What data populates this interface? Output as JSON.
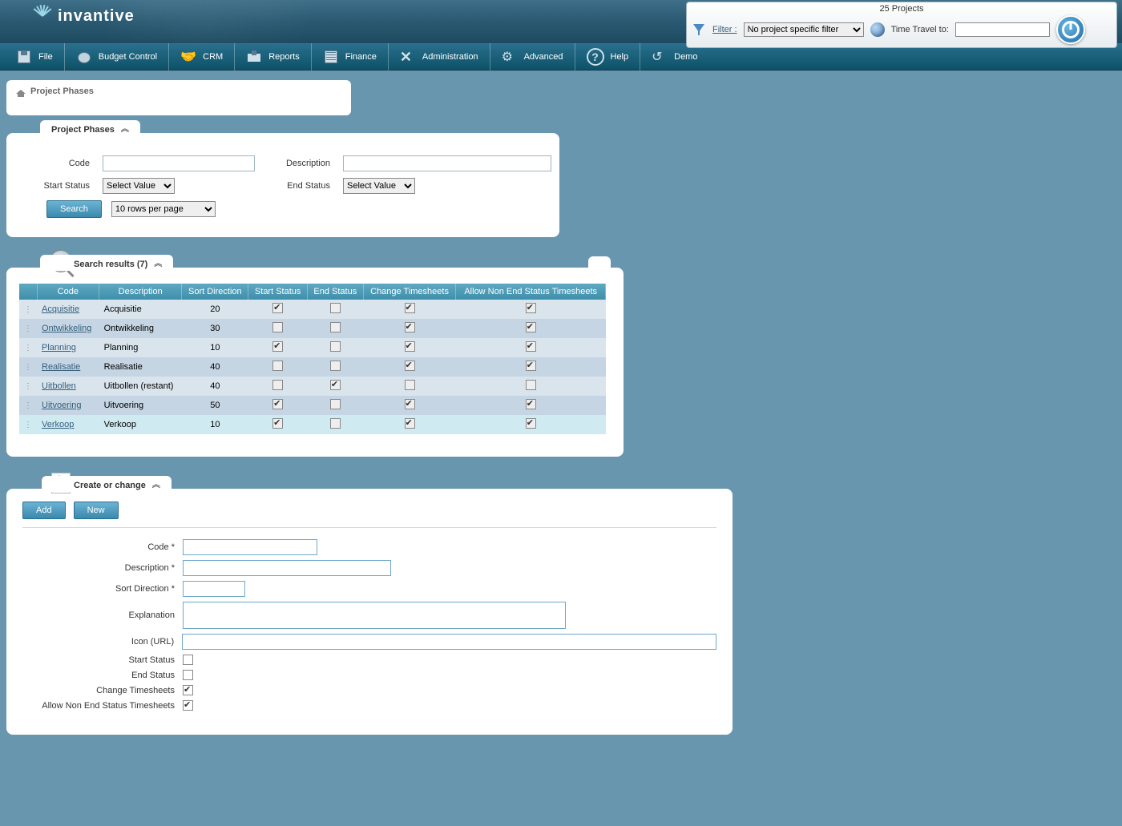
{
  "brand": "invantive",
  "topright": {
    "project_count": "25 Projects",
    "filter_label": "Filter :",
    "filter_value": "No project specific filter",
    "time_travel_label": "Time Travel to:"
  },
  "menu": {
    "file": "File",
    "budget": "Budget Control",
    "crm": "CRM",
    "reports": "Reports",
    "finance": "Finance",
    "admin": "Administration",
    "advanced": "Advanced",
    "help": "Help",
    "demo": "Demo"
  },
  "breadcrumb": "Project Phases",
  "search_panel": {
    "title": "Project Phases",
    "code_label": "Code",
    "desc_label": "Description",
    "start_label": "Start Status",
    "end_label": "End Status",
    "select_value": "Select Value",
    "rows_per_page": "10 rows per page",
    "search_btn": "Search"
  },
  "results": {
    "title": "Search results (7)",
    "headers": {
      "code": "Code",
      "desc": "Description",
      "sort": "Sort Direction",
      "start": "Start Status",
      "end": "End Status",
      "change": "Change Timesheets",
      "allow": "Allow Non End Status Timesheets"
    },
    "rows": [
      {
        "code": "Acquisitie",
        "desc": "Acquisitie",
        "sort": "20",
        "start": true,
        "end": false,
        "change": true,
        "allow": true
      },
      {
        "code": "Ontwikkeling",
        "desc": "Ontwikkeling",
        "sort": "30",
        "start": false,
        "end": false,
        "change": true,
        "allow": true
      },
      {
        "code": "Planning",
        "desc": "Planning",
        "sort": "10",
        "start": true,
        "end": false,
        "change": true,
        "allow": true
      },
      {
        "code": "Realisatie",
        "desc": "Realisatie",
        "sort": "40",
        "start": false,
        "end": false,
        "change": true,
        "allow": true
      },
      {
        "code": "Uitbollen",
        "desc": "Uitbollen (restant)",
        "sort": "40",
        "start": false,
        "end": true,
        "change": false,
        "allow": false
      },
      {
        "code": "Uitvoering",
        "desc": "Uitvoering",
        "sort": "50",
        "start": true,
        "end": false,
        "change": true,
        "allow": true
      },
      {
        "code": "Verkoop",
        "desc": "Verkoop",
        "sort": "10",
        "start": true,
        "end": false,
        "change": true,
        "allow": true
      }
    ]
  },
  "create": {
    "title": "Create or change",
    "add_btn": "Add",
    "new_btn": "New",
    "code_label": "Code *",
    "desc_label": "Description *",
    "sort_label": "Sort Direction *",
    "expl_label": "Explanation",
    "icon_label": "Icon (URL)",
    "start_label": "Start Status",
    "end_label": "End Status",
    "change_label": "Change Timesheets",
    "allow_label": "Allow Non End Status Timesheets",
    "start_val": false,
    "end_val": false,
    "change_val": true,
    "allow_val": true
  }
}
